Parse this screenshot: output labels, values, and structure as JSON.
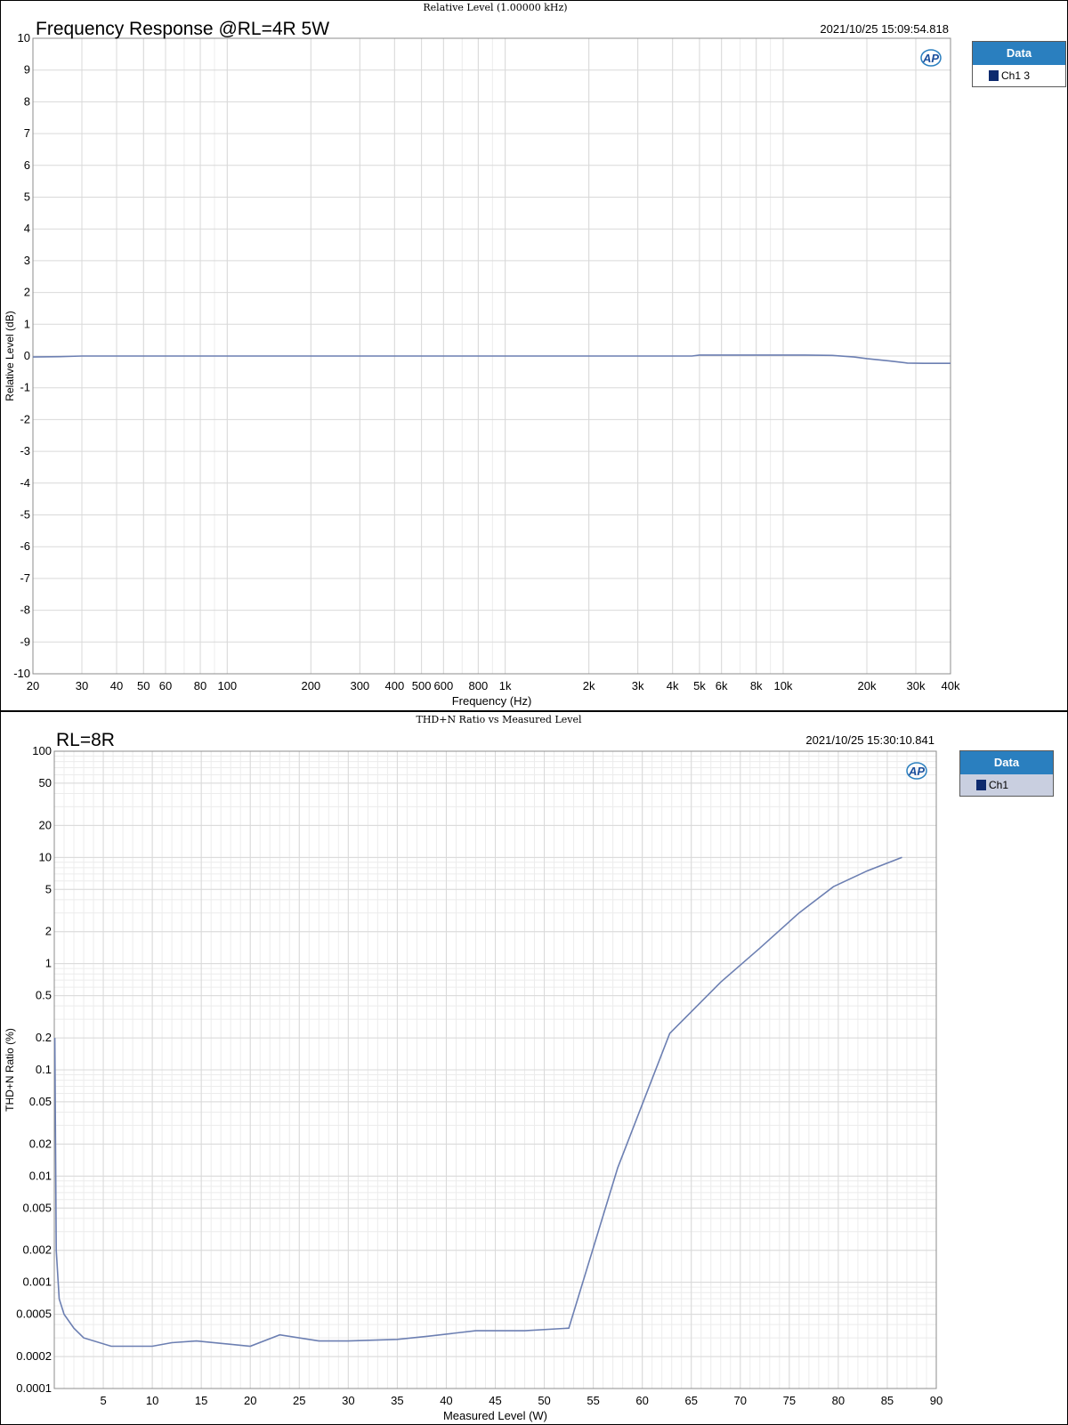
{
  "charts": [
    {
      "header": "Relative Level (1.00000 kHz)",
      "title": "Frequency Response @RL=4R  5W",
      "timestamp": "2021/10/25 15:09:54.818",
      "legend": {
        "header": "Data",
        "entries": [
          "Ch1 3"
        ]
      }
    },
    {
      "header": "THD+N Ratio vs Measured Level",
      "title": "RL=8R",
      "timestamp": "2021/10/25 15:30:10.841",
      "legend": {
        "header": "Data",
        "entries": [
          "Ch1"
        ]
      }
    }
  ],
  "logo_text": "AP",
  "colors": {
    "series": "#6c7fb2",
    "grid": "#d9d9d9",
    "legend_header": "#2a7fbf",
    "swatch": "#0d2a6e"
  },
  "chart_data": [
    {
      "type": "line",
      "title": "Frequency Response @RL=4R  5W",
      "xlabel": "Frequency (Hz)",
      "ylabel": "Relative Level (dB)",
      "xscale": "log",
      "xlim": [
        20,
        40000
      ],
      "ylim": [
        -10,
        10
      ],
      "xticks": [
        20,
        30,
        40,
        50,
        60,
        80,
        100,
        200,
        300,
        400,
        500,
        600,
        800,
        1000,
        2000,
        3000,
        4000,
        5000,
        6000,
        8000,
        10000,
        20000,
        30000,
        40000
      ],
      "xtick_labels": [
        "20",
        "30",
        "40",
        "50",
        "60",
        "80",
        "100",
        "200",
        "300",
        "400",
        "500",
        "600",
        "800",
        "1k",
        "2k",
        "3k",
        "4k",
        "5k",
        "6k",
        "8k",
        "10k",
        "20k",
        "30k",
        "40k"
      ],
      "yticks": [
        -10,
        -9,
        -8,
        -7,
        -6,
        -5,
        -4,
        -3,
        -2,
        -1,
        0,
        1,
        2,
        3,
        4,
        5,
        6,
        7,
        8,
        9,
        10
      ],
      "grid": true,
      "legend_position": "right",
      "series": [
        {
          "name": "Ch1 3",
          "x": [
            20,
            25,
            30,
            50,
            100,
            200,
            500,
            1000,
            2000,
            4000,
            4700,
            5000,
            8000,
            12000,
            15000,
            18000,
            20000,
            24000,
            28000,
            32000,
            40000
          ],
          "y": [
            -0.03,
            -0.02,
            0.0,
            0.0,
            0.0,
            0.0,
            0.0,
            0.0,
            0.0,
            0.0,
            0.0,
            0.03,
            0.03,
            0.03,
            0.02,
            -0.03,
            -0.08,
            -0.15,
            -0.22,
            -0.23,
            -0.23
          ]
        }
      ]
    },
    {
      "type": "line",
      "title": "RL=8R",
      "xlabel": "Measured Level (W)",
      "ylabel": "THD+N Ratio (%)",
      "yscale": "log",
      "xlim": [
        0,
        90
      ],
      "ylim": [
        0.0001,
        100
      ],
      "xticks": [
        5,
        10,
        15,
        20,
        25,
        30,
        35,
        40,
        45,
        50,
        55,
        60,
        65,
        70,
        75,
        80,
        85,
        90
      ],
      "yticks": [
        0.0001,
        0.0002,
        0.0005,
        0.001,
        0.002,
        0.005,
        0.01,
        0.02,
        0.05,
        0.1,
        0.2,
        0.5,
        1,
        2,
        5,
        10,
        20,
        50,
        100
      ],
      "ytick_labels": [
        "0.0001",
        "0.0002",
        "0.0005",
        "0.001",
        "0.002",
        "0.005",
        "0.01",
        "0.02",
        "0.05",
        "0.1",
        "0.2",
        "0.5",
        "1",
        "2",
        "5",
        "10",
        "20",
        "50",
        "100"
      ],
      "grid": true,
      "legend_position": "right",
      "series": [
        {
          "name": "Ch1",
          "x": [
            0.05,
            0.2,
            0.5,
            1,
            2,
            3,
            5.8,
            10,
            12,
            14.5,
            20,
            23,
            27,
            30,
            35,
            38,
            43,
            48,
            52.5,
            57.5,
            62.8,
            68,
            72,
            76,
            79.5,
            83,
            86.5
          ],
          "y": [
            0.2,
            0.002,
            0.0007,
            0.0005,
            0.00037,
            0.0003,
            0.00025,
            0.00025,
            0.00027,
            0.00028,
            0.00025,
            0.00032,
            0.00028,
            0.00028,
            0.00029,
            0.00031,
            0.00035,
            0.00035,
            0.00037,
            0.012,
            0.22,
            0.67,
            1.4,
            3.0,
            5.3,
            7.5,
            10.0
          ]
        }
      ]
    }
  ]
}
